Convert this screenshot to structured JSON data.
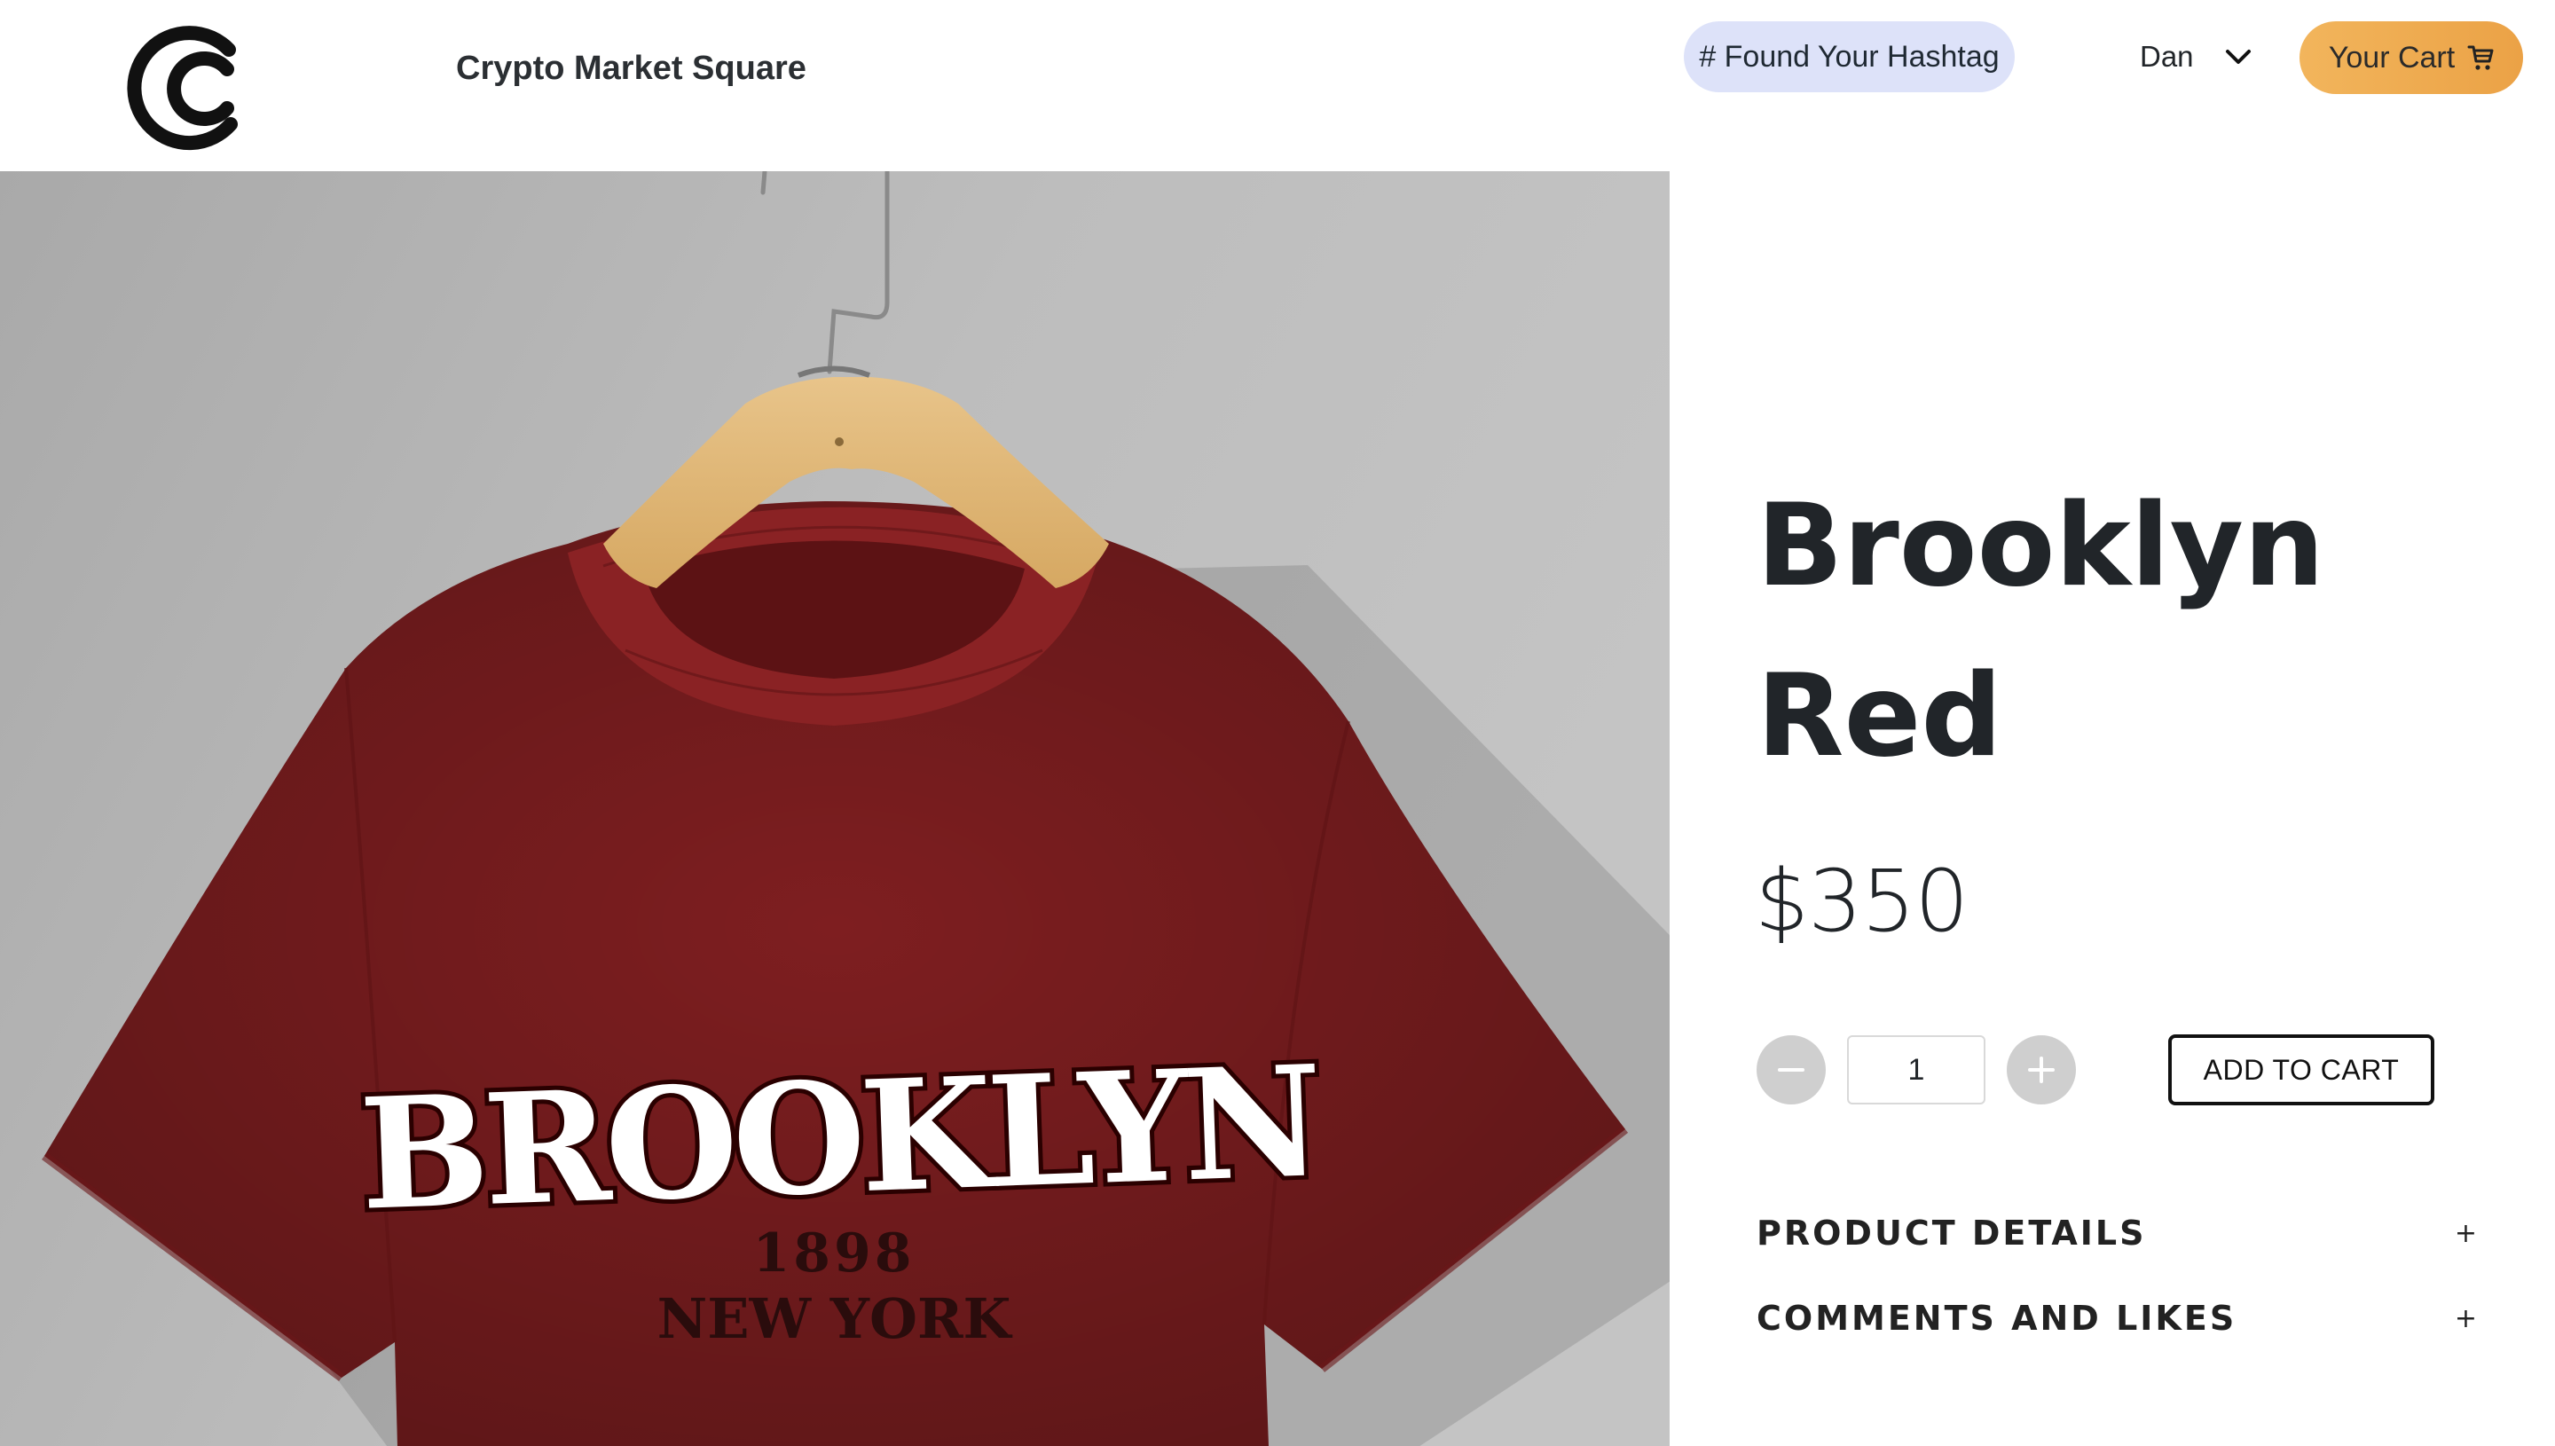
{
  "header": {
    "brand": "Crypto Market Square",
    "hashtag_button": "# Found Your Hashtag",
    "user_name": "Dan",
    "cart_button": "Your Cart"
  },
  "product": {
    "name": "Brooklyn Red",
    "price": "$350",
    "quantity": "1",
    "add_to_cart": "ADD TO CART",
    "image": {
      "print_main": "BROOKLYN",
      "print_year": "1898",
      "print_city": "NEW YORK"
    }
  },
  "accordion": [
    {
      "label": "PRODUCT DETAILS",
      "toggle": "+"
    },
    {
      "label": "COMMENTS AND LIKES",
      "toggle": "+"
    }
  ],
  "icons": {
    "logo": "crypto-market-square-logo",
    "user_menu": "chevron-down-icon",
    "cart": "shopping-cart-icon",
    "decrease": "minus-icon",
    "increase": "plus-icon"
  },
  "colors": {
    "hashtag_bg": "#dde2f9",
    "cart_bg": "#f0ad50",
    "shirt": "#7e1e20",
    "qty_buttons": "#cfcfcf"
  }
}
